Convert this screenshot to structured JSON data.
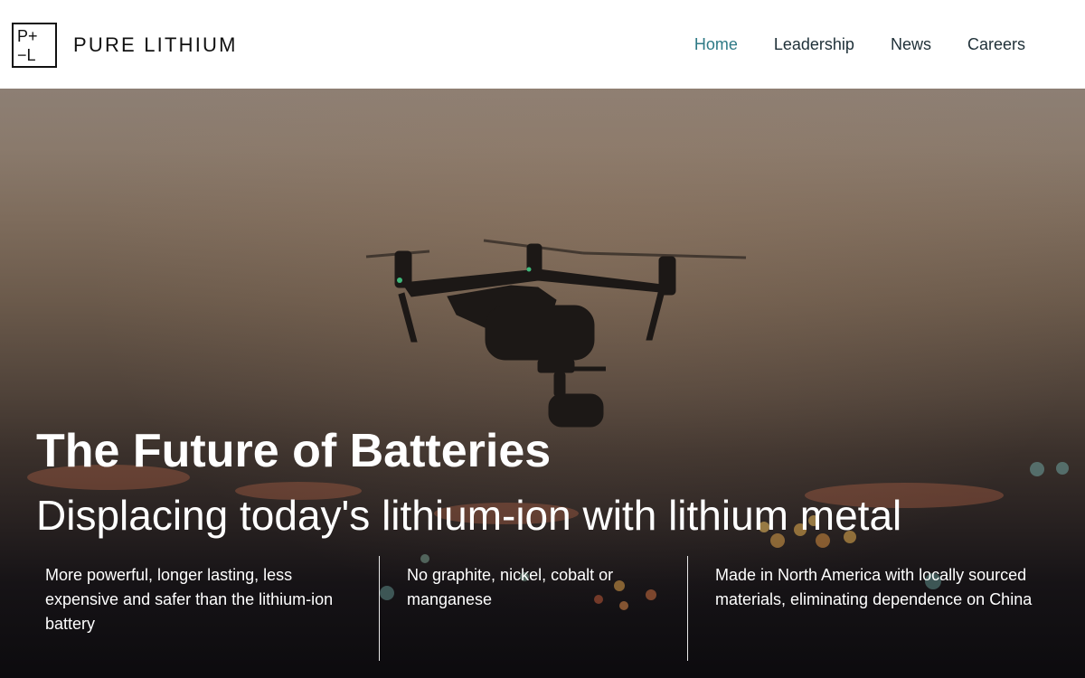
{
  "header": {
    "logo": {
      "mark_top": "P+",
      "mark_bottom": "−L",
      "wordmark": "PURE LITHIUM"
    },
    "nav": [
      {
        "label": "Home",
        "active": true
      },
      {
        "label": "Leadership",
        "active": false
      },
      {
        "label": "News",
        "active": false
      },
      {
        "label": "Careers",
        "active": false
      }
    ]
  },
  "hero": {
    "background_image": "drone-at-dusk-photo",
    "title": "The Future of Batteries",
    "subtitle": "Displacing today's lithium-ion with lithium metal",
    "features": [
      {
        "text": "More powerful, longer lasting, less expensive and safer than the lithium-ion battery"
      },
      {
        "text": "No graphite, nickel, cobalt or manganese"
      },
      {
        "text": "Made in North America with locally sourced materials, eliminating dependence on China"
      }
    ]
  },
  "colors": {
    "nav_text": "#1f3038",
    "nav_active": "#2f7a86",
    "hero_text": "#ffffff",
    "header_bg": "#ffffff"
  }
}
